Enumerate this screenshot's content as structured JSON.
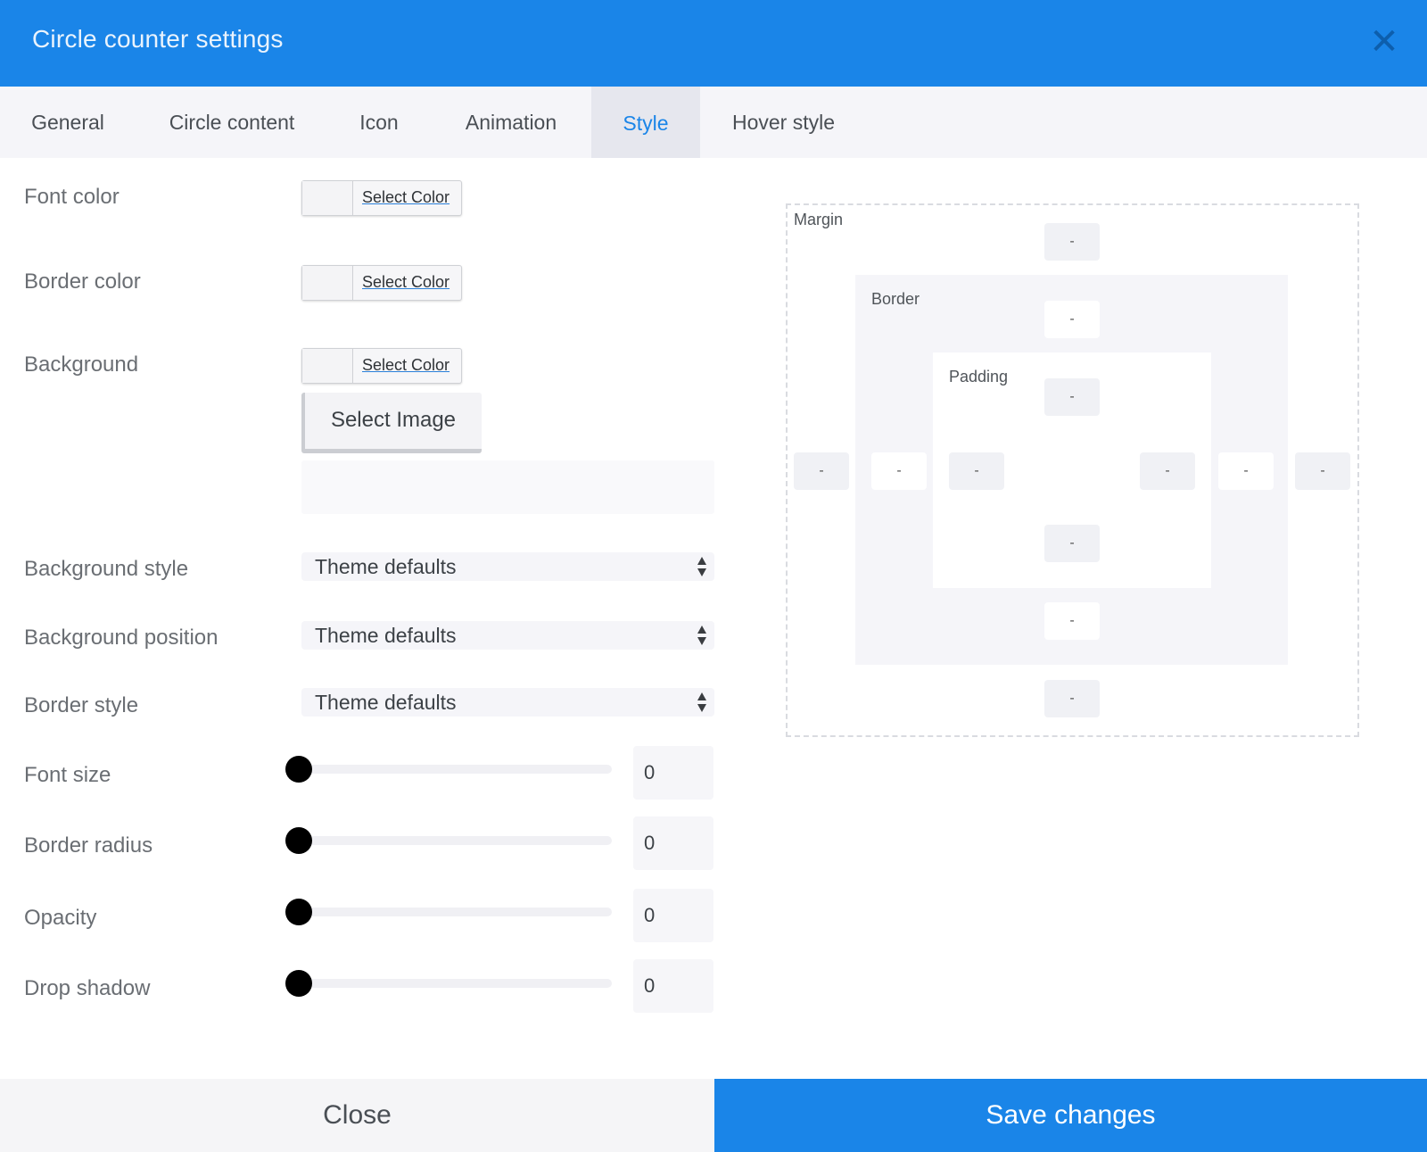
{
  "dialog": {
    "title": "Circle counter settings",
    "close_icon": "close-icon"
  },
  "tabs": [
    {
      "label": "General",
      "active": false
    },
    {
      "label": "Circle content",
      "active": false
    },
    {
      "label": "Icon",
      "active": false
    },
    {
      "label": "Animation",
      "active": false
    },
    {
      "label": "Style",
      "active": true
    },
    {
      "label": "Hover style",
      "active": false
    }
  ],
  "colors": {
    "accent": "#1a85e8",
    "slider_thumb": "#000000"
  },
  "fields": {
    "font_color": {
      "label": "Font color",
      "button": "Select Color"
    },
    "border_color": {
      "label": "Border color",
      "button": "Select Color"
    },
    "background": {
      "label": "Background",
      "button": "Select Color",
      "image_button": "Select Image",
      "image_value": ""
    },
    "background_style": {
      "label": "Background style",
      "value": "Theme defaults"
    },
    "background_position": {
      "label": "Background position",
      "value": "Theme defaults"
    },
    "border_style": {
      "label": "Border style",
      "value": "Theme defaults"
    },
    "font_size": {
      "label": "Font size",
      "value": "0"
    },
    "border_radius": {
      "label": "Border radius",
      "value": "0"
    },
    "opacity": {
      "label": "Opacity",
      "value": "0"
    },
    "drop_shadow": {
      "label": "Drop shadow",
      "value": "0"
    }
  },
  "box_model": {
    "margin": {
      "label": "Margin",
      "top": "-",
      "right": "-",
      "bottom": "-",
      "left": "-"
    },
    "border": {
      "label": "Border",
      "top": "-",
      "right": "-",
      "bottom": "-",
      "left": "-"
    },
    "padding": {
      "label": "Padding",
      "top": "-",
      "right": "-",
      "bottom": "-",
      "left": "-"
    }
  },
  "footer": {
    "close_label": "Close",
    "save_label": "Save changes"
  }
}
